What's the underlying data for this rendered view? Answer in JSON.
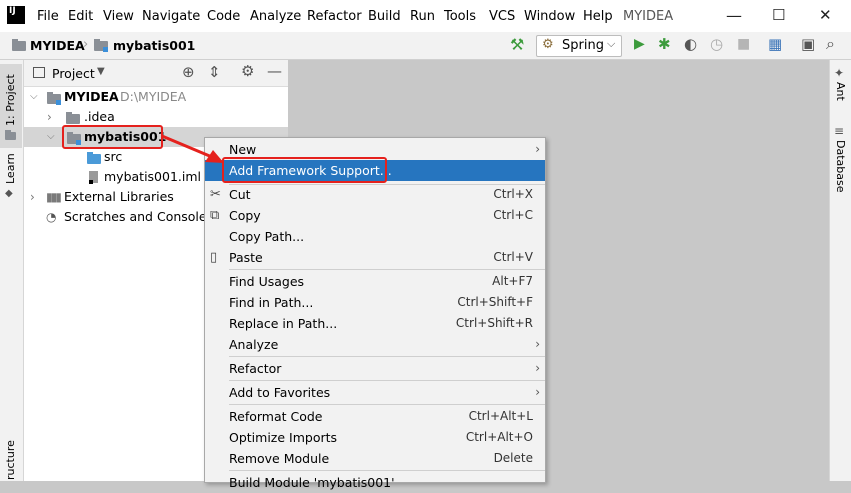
{
  "menubar": {
    "logo": "IJ",
    "items": [
      "File",
      "Edit",
      "View",
      "Navigate",
      "Code",
      "Analyze",
      "Refactor",
      "Build",
      "Run",
      "Tools",
      "VCS",
      "Window",
      "Help"
    ],
    "app_title": "MYIDEA",
    "minimize": "—",
    "maximize": "☐",
    "close": "✕"
  },
  "navbar": {
    "crumb_project": "MYIDEA",
    "crumb_module": "mybatis001",
    "run_config": "Spring"
  },
  "left_stripe": {
    "project_tab": "1: Project",
    "learn_tab": "Learn",
    "structure_tab": "ructure"
  },
  "panel": {
    "title": "Project"
  },
  "tree": {
    "root_name": "MYIDEA",
    "root_path": "D:\\MYIDEA",
    "idea": ".idea",
    "module": "mybatis001",
    "src": "src",
    "iml": "mybatis001.iml",
    "external_libraries": "External Libraries",
    "scratches": "Scratches and Consoles"
  },
  "right_stripe": {
    "ant": "Ant",
    "database": "Database"
  },
  "context_menu": {
    "items": [
      {
        "label": "New",
        "shortcut": "",
        "submenu": true
      },
      {
        "label": "Add Framework Support...",
        "shortcut": "",
        "submenu": false
      },
      {
        "label": "Cut",
        "shortcut": "Ctrl+X",
        "submenu": false
      },
      {
        "label": "Copy",
        "shortcut": "Ctrl+C",
        "submenu": false
      },
      {
        "label": "Copy Path...",
        "shortcut": "",
        "submenu": false
      },
      {
        "label": "Paste",
        "shortcut": "Ctrl+V",
        "submenu": false
      },
      {
        "label": "Find Usages",
        "shortcut": "Alt+F7",
        "submenu": false
      },
      {
        "label": "Find in Path...",
        "shortcut": "Ctrl+Shift+F",
        "submenu": false
      },
      {
        "label": "Replace in Path...",
        "shortcut": "Ctrl+Shift+R",
        "submenu": false
      },
      {
        "label": "Analyze",
        "shortcut": "",
        "submenu": true
      },
      {
        "label": "Refactor",
        "shortcut": "",
        "submenu": true
      },
      {
        "label": "Add to Favorites",
        "shortcut": "",
        "submenu": true
      },
      {
        "label": "Reformat Code",
        "shortcut": "Ctrl+Alt+L",
        "submenu": false
      },
      {
        "label": "Optimize Imports",
        "shortcut": "Ctrl+Alt+O",
        "submenu": false
      },
      {
        "label": "Remove Module",
        "shortcut": "Delete",
        "submenu": false
      },
      {
        "label": "Build Module 'mybatis001'",
        "shortcut": "",
        "submenu": false
      }
    ]
  },
  "colors": {
    "highlight": "#2675bf",
    "annotation_red": "#e5211d",
    "run_green": "#3c9b3c"
  }
}
